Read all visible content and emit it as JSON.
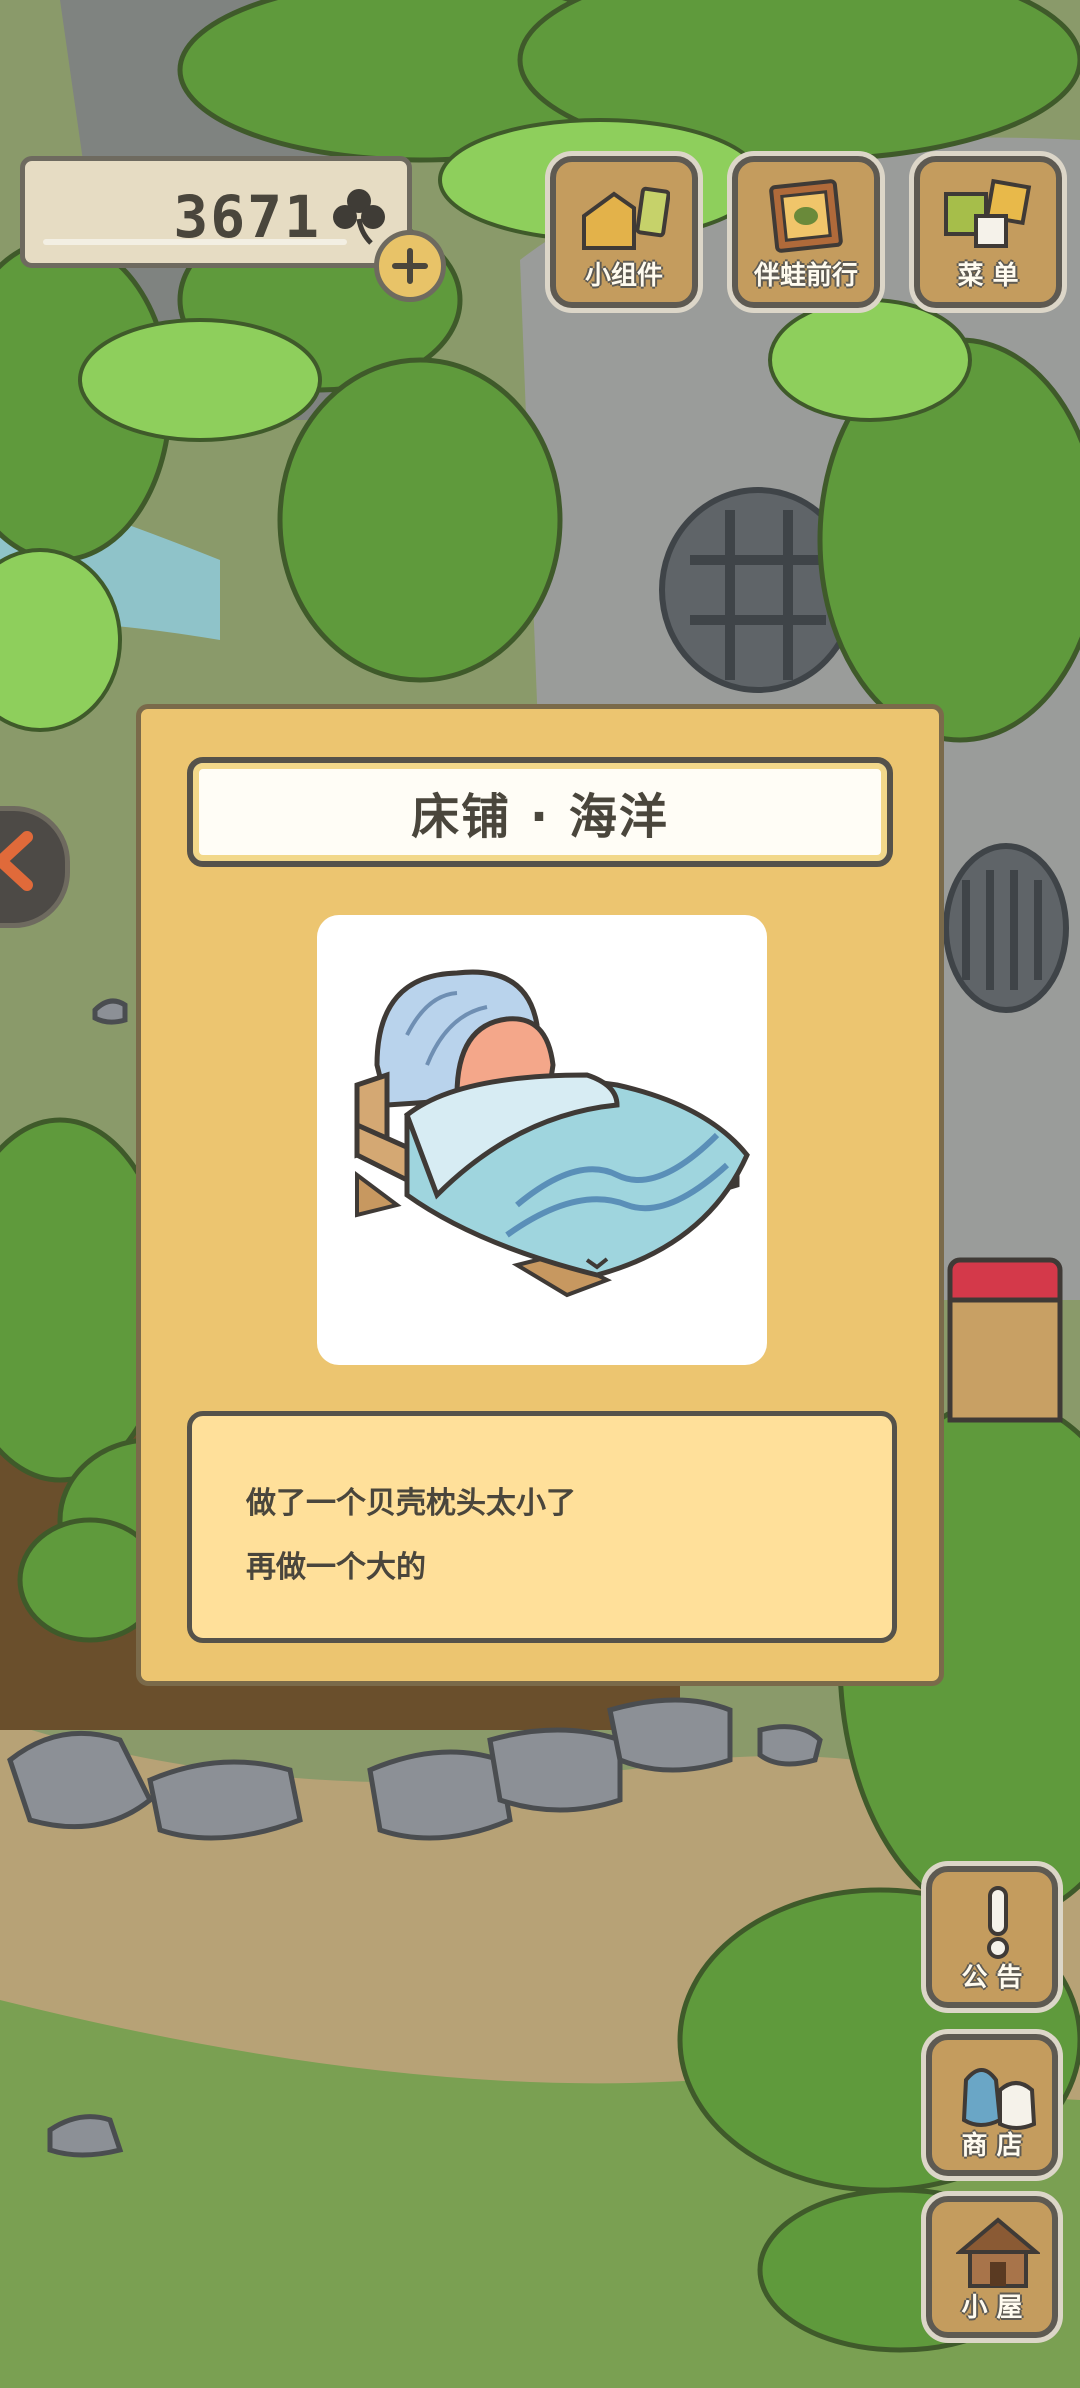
{
  "hud": {
    "clover_count": "3671",
    "clover_icon": "clover-icon",
    "add_icon": "plus-icon"
  },
  "top_buttons": [
    {
      "label": "小组件",
      "icon": "widget-icon"
    },
    {
      "label": "伴蛙前行",
      "icon": "journey-book-icon"
    },
    {
      "label": "菜 单",
      "icon": "menu-cards-icon"
    }
  ],
  "side_buttons": [
    {
      "label": "公 告",
      "icon": "exclamation-icon"
    },
    {
      "label": "商 店",
      "icon": "shop-bags-icon"
    },
    {
      "label": "小 屋",
      "icon": "house-icon"
    }
  ],
  "modal": {
    "title": "床铺 · 海洋",
    "item_image": "seashell-bed-icon",
    "description": [
      "做了一个贝壳枕头太小了",
      "再做一个大的"
    ]
  },
  "colors": {
    "modal_bg": "#ecc570",
    "desc_bg": "#ffe09a",
    "button_wood": "#c49c5e",
    "text_dark": "#4a463c"
  }
}
